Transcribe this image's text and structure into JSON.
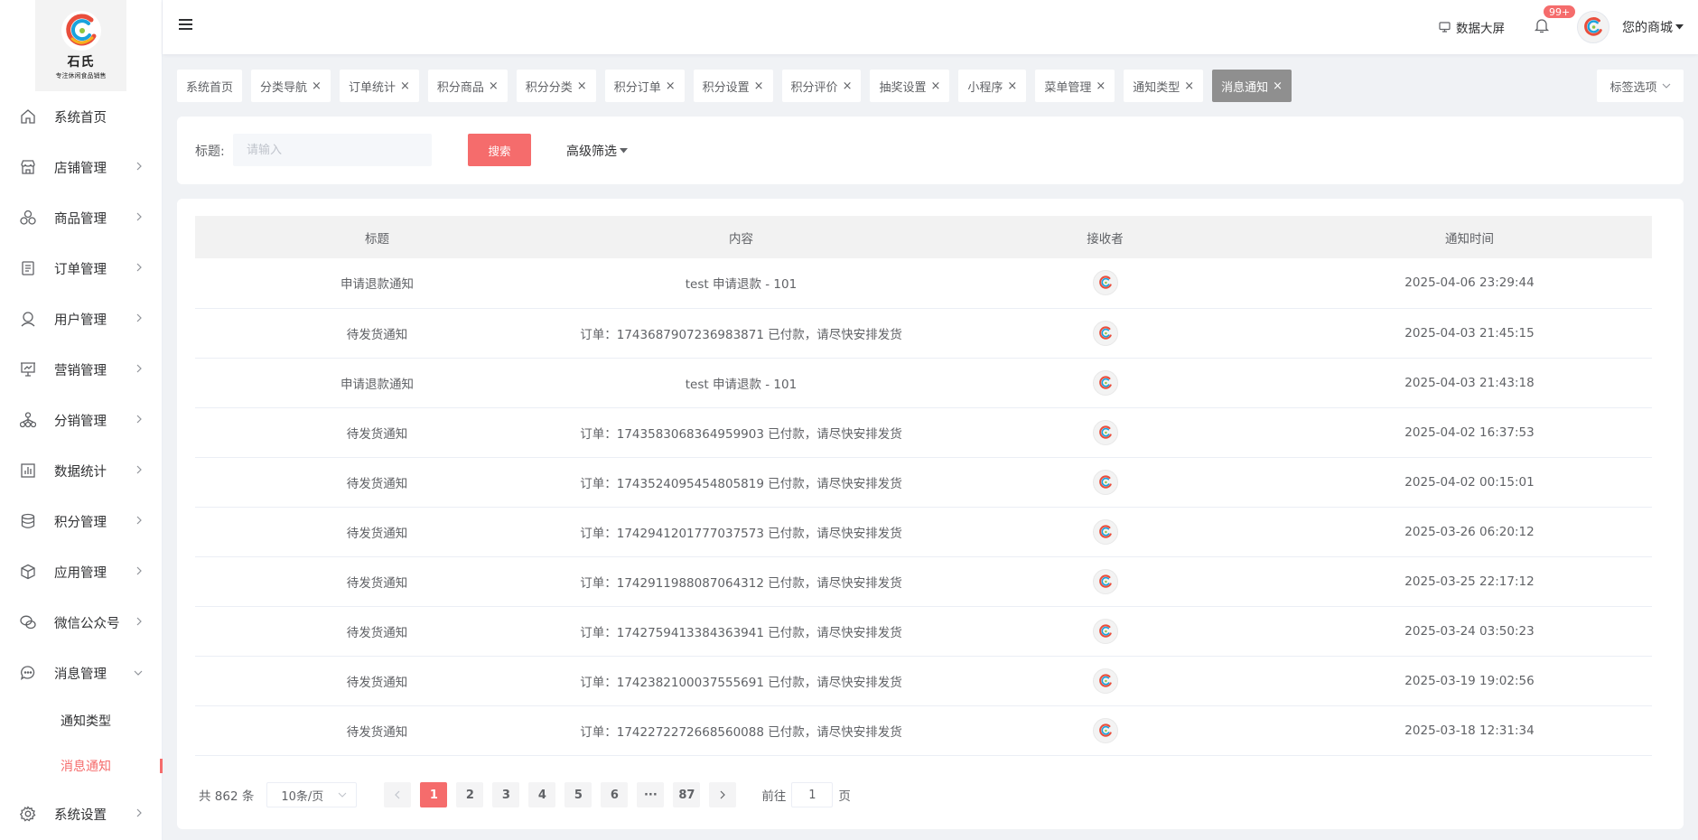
{
  "brand": {
    "name": "石氏",
    "slogan": "专注休闲食品销售"
  },
  "sidebar": {
    "items": [
      {
        "label": "系统首页",
        "icon": "home-icon",
        "has_arrow": false
      },
      {
        "label": "店铺管理",
        "icon": "store-icon",
        "has_arrow": true
      },
      {
        "label": "商品管理",
        "icon": "goods-icon",
        "has_arrow": true
      },
      {
        "label": "订单管理",
        "icon": "order-icon",
        "has_arrow": true
      },
      {
        "label": "用户管理",
        "icon": "user-icon",
        "has_arrow": true
      },
      {
        "label": "营销管理",
        "icon": "marketing-icon",
        "has_arrow": true
      },
      {
        "label": "分销管理",
        "icon": "distribution-icon",
        "has_arrow": true
      },
      {
        "label": "数据统计",
        "icon": "stats-icon",
        "has_arrow": true
      },
      {
        "label": "积分管理",
        "icon": "points-icon",
        "has_arrow": true
      },
      {
        "label": "应用管理",
        "icon": "app-icon",
        "has_arrow": true
      },
      {
        "label": "微信公众号",
        "icon": "wechat-icon",
        "has_arrow": true
      },
      {
        "label": "消息管理",
        "icon": "message-icon",
        "has_arrow": true,
        "expanded": true
      },
      {
        "label": "系统设置",
        "icon": "settings-icon",
        "has_arrow": true
      }
    ],
    "message_submenu": [
      {
        "label": "通知类型",
        "active": false
      },
      {
        "label": "消息通知",
        "active": true
      }
    ]
  },
  "header": {
    "big_screen_label": "数据大屏",
    "notification_badge": "99+",
    "shop_name": "您的商城"
  },
  "tags": [
    {
      "label": "系统首页",
      "closable": false
    },
    {
      "label": "分类导航",
      "closable": true
    },
    {
      "label": "订单统计",
      "closable": true
    },
    {
      "label": "积分商品",
      "closable": true
    },
    {
      "label": "积分分类",
      "closable": true
    },
    {
      "label": "积分订单",
      "closable": true
    },
    {
      "label": "积分设置",
      "closable": true
    },
    {
      "label": "积分评价",
      "closable": true
    },
    {
      "label": "抽奖设置",
      "closable": true
    },
    {
      "label": "小程序",
      "closable": true
    },
    {
      "label": "菜单管理",
      "closable": true
    },
    {
      "label": "通知类型",
      "closable": true
    },
    {
      "label": "消息通知",
      "closable": true,
      "active": true
    }
  ],
  "tag_options_label": "标签选项",
  "search": {
    "label": "标题:",
    "placeholder": "请输入",
    "button_label": "搜索",
    "advanced_label": "高级筛选"
  },
  "table": {
    "columns": [
      "标题",
      "内容",
      "接收者",
      "通知时间"
    ],
    "rows": [
      {
        "title": "申请退款通知",
        "content": "test 申请退款 - 101",
        "time": "2025-04-06 23:29:44"
      },
      {
        "title": "待发货通知",
        "content": "订单：1743687907236983871 已付款，请尽快安排发货",
        "time": "2025-04-03 21:45:15"
      },
      {
        "title": "申请退款通知",
        "content": "test 申请退款 - 101",
        "time": "2025-04-03 21:43:18"
      },
      {
        "title": "待发货通知",
        "content": "订单：1743583068364959903 已付款，请尽快安排发货",
        "time": "2025-04-02 16:37:53"
      },
      {
        "title": "待发货通知",
        "content": "订单：1743524095454805819 已付款，请尽快安排发货",
        "time": "2025-04-02 00:15:01"
      },
      {
        "title": "待发货通知",
        "content": "订单：1742941201777037573 已付款，请尽快安排发货",
        "time": "2025-03-26 06:20:12"
      },
      {
        "title": "待发货通知",
        "content": "订单：1742911988087064312 已付款，请尽快安排发货",
        "time": "2025-03-25 22:17:12"
      },
      {
        "title": "待发货通知",
        "content": "订单：1742759413384363941 已付款，请尽快安排发货",
        "time": "2025-03-24 03:50:23"
      },
      {
        "title": "待发货通知",
        "content": "订单：1742382100037555691 已付款，请尽快安排发货",
        "time": "2025-03-19 19:02:56"
      },
      {
        "title": "待发货通知",
        "content": "订单：1742272272668560088 已付款，请尽快安排发货",
        "time": "2025-03-18 12:31:34"
      }
    ]
  },
  "pagination": {
    "total_text": "共 862 条",
    "page_size": "10条/页",
    "pages": [
      "1",
      "2",
      "3",
      "4",
      "5",
      "6",
      "···",
      "87"
    ],
    "current": "1",
    "goto_prefix": "前往",
    "goto_value": "1",
    "goto_suffix": "页"
  },
  "colors": {
    "accent": "#f56c6c",
    "active_tag": "#8f8f8f",
    "sidebar_bg": "#ffffff",
    "page_bg": "#f0f2f5"
  }
}
